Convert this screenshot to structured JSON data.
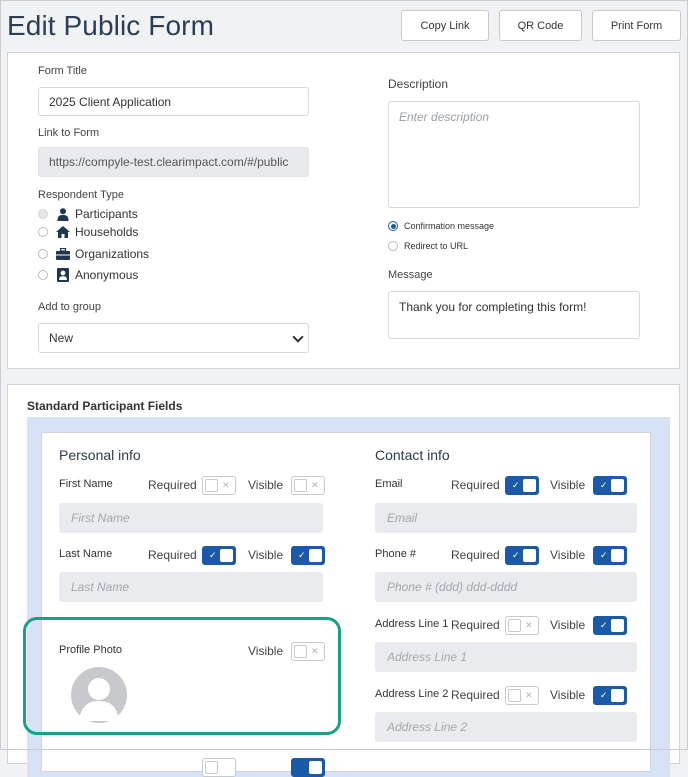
{
  "page": {
    "title": "Edit Public Form",
    "buttons": {
      "copy_link": "Copy Link",
      "qr_code": "QR Code",
      "print_form": "Print Form"
    }
  },
  "form": {
    "title_label": "Form Title",
    "title_value": "2025 Client Application",
    "link_label": "Link to Form",
    "link_value": "https://compyle-test.clearimpact.com/#/public",
    "respondent_label": "Respondent Type",
    "respondent_types": [
      {
        "label": "Participants",
        "icon": "user-icon",
        "state": "selected-disabled"
      },
      {
        "label": "Households",
        "icon": "home-icon",
        "state": "unselected"
      },
      {
        "label": "Organizations",
        "icon": "briefcase-icon",
        "state": "unselected"
      },
      {
        "label": "Anonymous",
        "icon": "id-card-icon",
        "state": "unselected"
      }
    ],
    "group_label": "Add to group",
    "group_value": "New",
    "description_label": "Description",
    "description_placeholder": "Enter description",
    "after_submit_options": [
      {
        "label": "Confirmation message",
        "checked": true
      },
      {
        "label": "Redirect to URL",
        "checked": false
      }
    ],
    "message_label": "Message",
    "message_value": "Thank you for completing this form!"
  },
  "standard_fields": {
    "title": "Standard Participant Fields",
    "required_label": "Required",
    "visible_label": "Visible",
    "personal": {
      "title": "Personal info",
      "fields": [
        {
          "name": "First Name",
          "placeholder": "First Name",
          "required": false,
          "visible": false
        },
        {
          "name": "Last Name",
          "placeholder": "Last Name",
          "required": true,
          "visible": true
        },
        {
          "name": "Profile Photo",
          "visible": false
        }
      ]
    },
    "contact": {
      "title": "Contact info",
      "fields": [
        {
          "name": "Email",
          "placeholder": "Email",
          "required": true,
          "visible": true
        },
        {
          "name": "Phone #",
          "placeholder": "Phone # (ddd) ddd-dddd",
          "required": true,
          "visible": true
        },
        {
          "name": "Address Line 1",
          "placeholder": "Address Line 1",
          "required": false,
          "visible": true
        },
        {
          "name": "Address Line 2",
          "placeholder": "Address Line 2",
          "required": false,
          "visible": true
        }
      ]
    }
  },
  "colors": {
    "accent": "#1a5aa8",
    "highlight": "#17a187",
    "band": "#d7e2f6"
  }
}
